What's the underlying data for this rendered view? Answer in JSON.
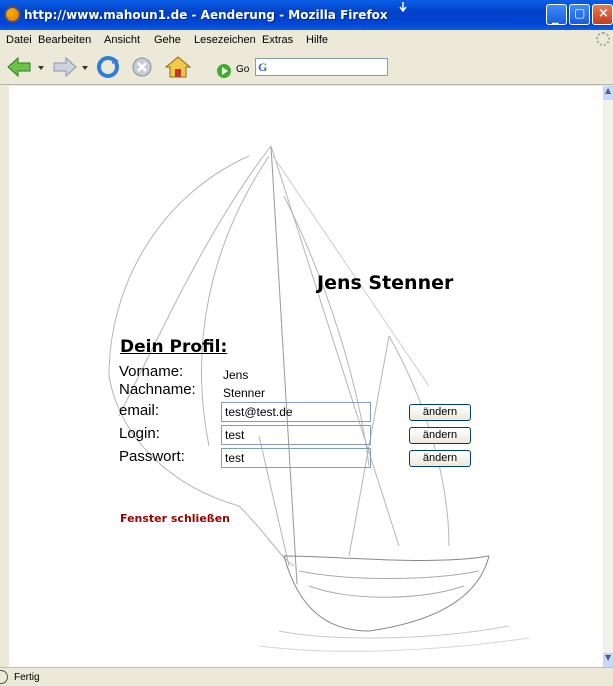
{
  "window": {
    "title": "http://www.mahoun1.de - Aenderung - Mozilla Firefox"
  },
  "menu": {
    "items": [
      "Datei",
      "Bearbeiten",
      "Ansicht",
      "Gehe",
      "Lesezeichen",
      "Extras",
      "Hilfe"
    ]
  },
  "toolbar": {
    "go_label": "Go",
    "url_value": ""
  },
  "page": {
    "heading": "Jens Stenner",
    "profile_title": "Dein Profil:",
    "fields": [
      {
        "label": "Vorname:",
        "value": "Jens"
      },
      {
        "label": "Nachname:",
        "value": "Stenner"
      },
      {
        "label": "email:",
        "value": "test@test.de",
        "button": "ändern"
      },
      {
        "label": "Login:",
        "value": "test",
        "button": "ändern"
      },
      {
        "label": "Passwort:",
        "value": "test",
        "button": "ändern"
      }
    ],
    "close_link": "Fenster schließen"
  },
  "status": {
    "text": "Fertig"
  },
  "colors": {
    "titlebar": "#0046d5",
    "link": "#990000",
    "chrome": "#ECE9D8"
  }
}
